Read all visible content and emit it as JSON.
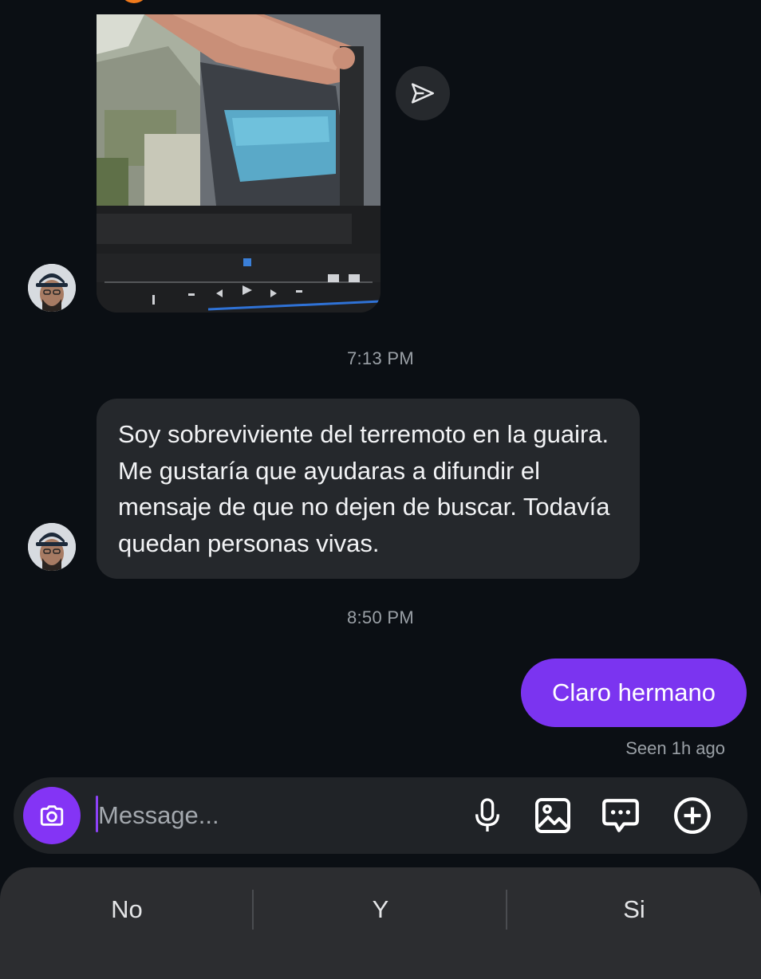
{
  "conversation": {
    "video_message": {
      "share_icon": "send-paper-plane-icon"
    },
    "timestamp_1": "7:13 PM",
    "incoming_text": "Soy sobreviviente del terremoto en la guaira. Me gustaría que ayudaras a difundir el mensaje de que no dejen de buscar. Todavía quedan personas vivas.",
    "timestamp_2": "8:50 PM",
    "outgoing_text": "Claro hermano",
    "seen_status": "Seen 1h ago"
  },
  "composer": {
    "placeholder": "Message...",
    "value": "",
    "camera_icon": "camera-icon",
    "tools": [
      "microphone-icon",
      "image-icon",
      "sticker-chat-icon",
      "plus-circle-icon"
    ]
  },
  "keyboard": {
    "suggestions": [
      "No",
      "Y",
      "Si"
    ]
  },
  "colors": {
    "background": "#0b0f14",
    "incoming_bubble": "#25282c",
    "outgoing_bubble": "#7b34f0",
    "accent": "#8434f5"
  }
}
